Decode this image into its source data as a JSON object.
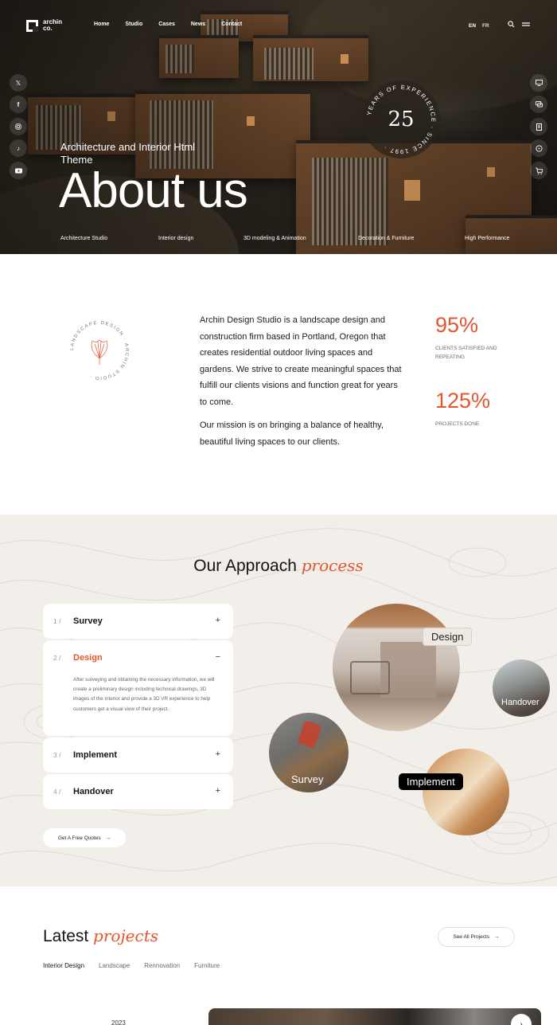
{
  "brand": {
    "logo_text": "archin\nco."
  },
  "nav": {
    "items": [
      "Home",
      "Studio",
      "Cases",
      "News",
      "Contact"
    ]
  },
  "lang": {
    "en": "EN",
    "fr": "FR"
  },
  "icons": {
    "search": "search-icon",
    "menu": "menu-icon",
    "social": [
      "x-icon",
      "facebook-icon",
      "instagram-icon",
      "tiktok-icon",
      "youtube-icon"
    ],
    "tools": [
      "monitor-icon",
      "chat-icon",
      "document-icon",
      "support-icon",
      "cart-icon"
    ]
  },
  "hero": {
    "subtitle": "Architecture and Interior Html Theme",
    "title": "About us",
    "badge": {
      "number": "25",
      "ring_text": "YEARS OF EXPERIENCE · SINCE 1997 ·"
    },
    "tags": [
      "Architecture Studio",
      "Interior design",
      "3D modeling & Animation",
      "Decoration & Furniture",
      "High Performance"
    ]
  },
  "about": {
    "seal_text": "LANDSCAPE DESIGN · ARCHIN STUDIO ·",
    "paragraph1": "Archin Design Studio is a landscape design and construction firm based in Portland, Oregon that creates residential outdoor living spaces and gardens. We strive to create meaningful spaces that fulfill our clients visions and function great for years to come.",
    "paragraph2": "Our mission is on bringing a balance of healthy, beautiful living spaces to our clients.",
    "stats": [
      {
        "value": "95%",
        "label": "CLIENTS SATISFIED AND REPEATING"
      },
      {
        "value": "125%",
        "label": "PROJECTS DONE"
      }
    ]
  },
  "approach": {
    "title_plain": "Our Approach ",
    "title_accent": "process",
    "steps": [
      {
        "num": "1 /",
        "title": "Survey",
        "sign": "+"
      },
      {
        "num": "2 /",
        "title": "Design",
        "sign": "−",
        "description": "After surveying and obtaining the necessary information, we will create a preliminary design including technical drawings, 3D images of the interior and provide a 3D VR experience to help customers get a visual view of their project."
      },
      {
        "num": "3 /",
        "title": "Implement",
        "sign": "+"
      },
      {
        "num": "4 /",
        "title": "Handover",
        "sign": "+"
      }
    ],
    "cta": "Get A Free Quotes",
    "circle_labels": {
      "design": "Design",
      "handover": "Handover",
      "survey": "Survey",
      "implement": "Implement"
    }
  },
  "projects": {
    "title_plain": "Latest ",
    "title_accent": "projects",
    "see_all": "See All Projects",
    "filters": [
      "Interior Design",
      "Landscape",
      "Rennovation",
      "Furniture"
    ],
    "year": "2023"
  },
  "colors": {
    "accent": "#e4572e",
    "section_bg": "#f2eeea",
    "hero_dark": "#2f2a22"
  }
}
